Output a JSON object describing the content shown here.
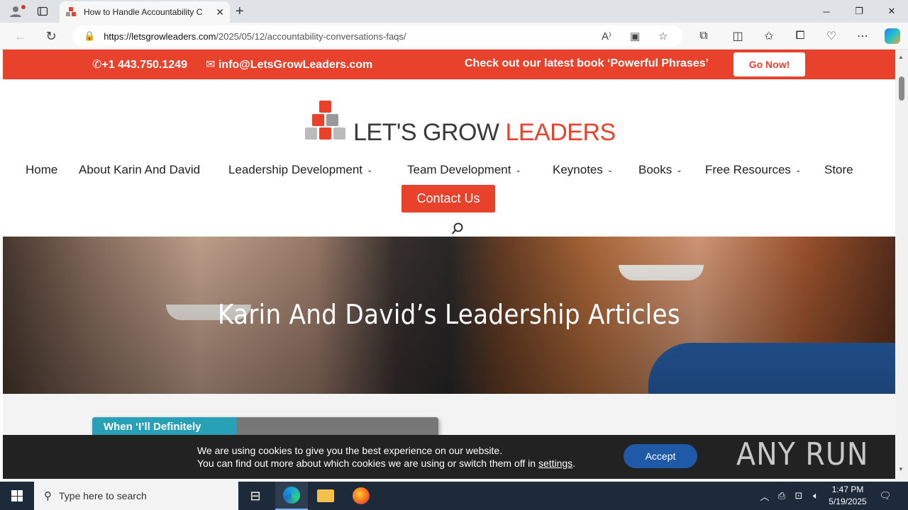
{
  "browser": {
    "tab_title": "How to Handle Accountability C",
    "url_host": "https://letsgrowleaders.com",
    "url_path": "/2025/05/12/accountability-conversations-faqs/"
  },
  "topbar": {
    "phone": "+1 443.750.1249",
    "email": "info@LetsGrowLeaders.com",
    "promo": "Check out our latest book ‘Powerful Phrases’",
    "cta": "Go Now!"
  },
  "logo": {
    "part1": "LET'S GROW ",
    "part2": "LEADERS"
  },
  "nav": {
    "items": [
      {
        "label": "Home",
        "has_dropdown": false
      },
      {
        "label": "About Karin And David",
        "has_dropdown": false
      },
      {
        "label": "Leadership Development",
        "has_dropdown": true
      },
      {
        "label": "Team Development",
        "has_dropdown": true
      },
      {
        "label": "Keynotes",
        "has_dropdown": true
      },
      {
        "label": "Books",
        "has_dropdown": true
      },
      {
        "label": "Free Resources",
        "has_dropdown": true
      },
      {
        "label": "Store",
        "has_dropdown": false
      }
    ],
    "contact": "Contact Us"
  },
  "hero": {
    "title": "Karin And David’s Leadership Articles"
  },
  "article_card": {
    "label": "When ‘I’ll Definitely"
  },
  "cookie": {
    "line1": "We are using cookies to give you the best experience on our website.",
    "line2": "You can find out more about which cookies we are using or switch them off in ",
    "settings_link": "settings",
    "line2_end": ".",
    "accept": "Accept",
    "brand": "ANY RUN"
  },
  "taskbar": {
    "search_placeholder": "Type here to search",
    "time": "1:47 PM",
    "date": "5/19/2025"
  },
  "colors": {
    "brand_red": "#e8412c",
    "teal": "#28a1b7",
    "accept_blue": "#1f5aa8"
  }
}
